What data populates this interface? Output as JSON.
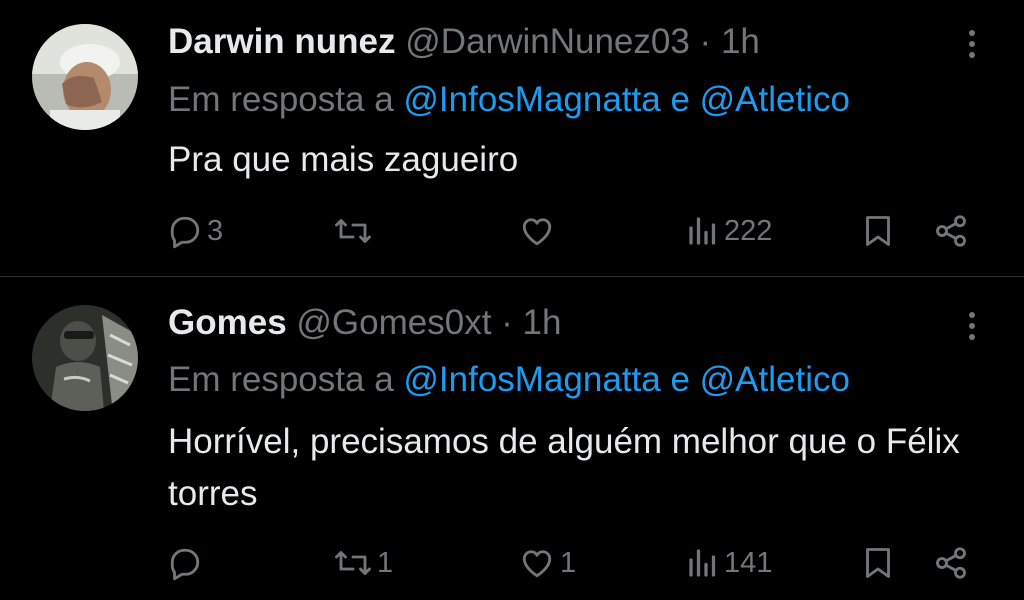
{
  "tweets": [
    {
      "name": "Darwin nunez",
      "handle": "@DarwinNunez03",
      "dot": "·",
      "time": "1h",
      "reply_prefix": "Em resposta a ",
      "reply_user1": "@InfosMagnatta",
      "reply_and": " e ",
      "reply_user2": "@Atletico",
      "text": "Pra que mais zagueiro",
      "replies": "3",
      "retweets": "",
      "likes": "",
      "views": "222"
    },
    {
      "name": "Gomes",
      "handle": "@Gomes0xt",
      "dot": "·",
      "time": "1h",
      "reply_prefix": "Em resposta a ",
      "reply_user1": "@InfosMagnatta",
      "reply_and": " e ",
      "reply_user2": "@Atletico",
      "text": "Horrível, precisamos de alguém melhor que o Félix torres",
      "replies": "",
      "retweets": "1",
      "likes": "1",
      "views": "141"
    }
  ],
  "icons": {
    "reply": "reply-icon",
    "retweet": "retweet-icon",
    "like": "heart-icon",
    "views": "views-icon",
    "bookmark": "bookmark-icon",
    "share": "share-icon",
    "more": "more-icon"
  },
  "colors": {
    "background": "#000000",
    "text": "#e7e9ea",
    "secondary": "#71767b",
    "link": "#1d9bf0",
    "divider": "#2f3336"
  }
}
